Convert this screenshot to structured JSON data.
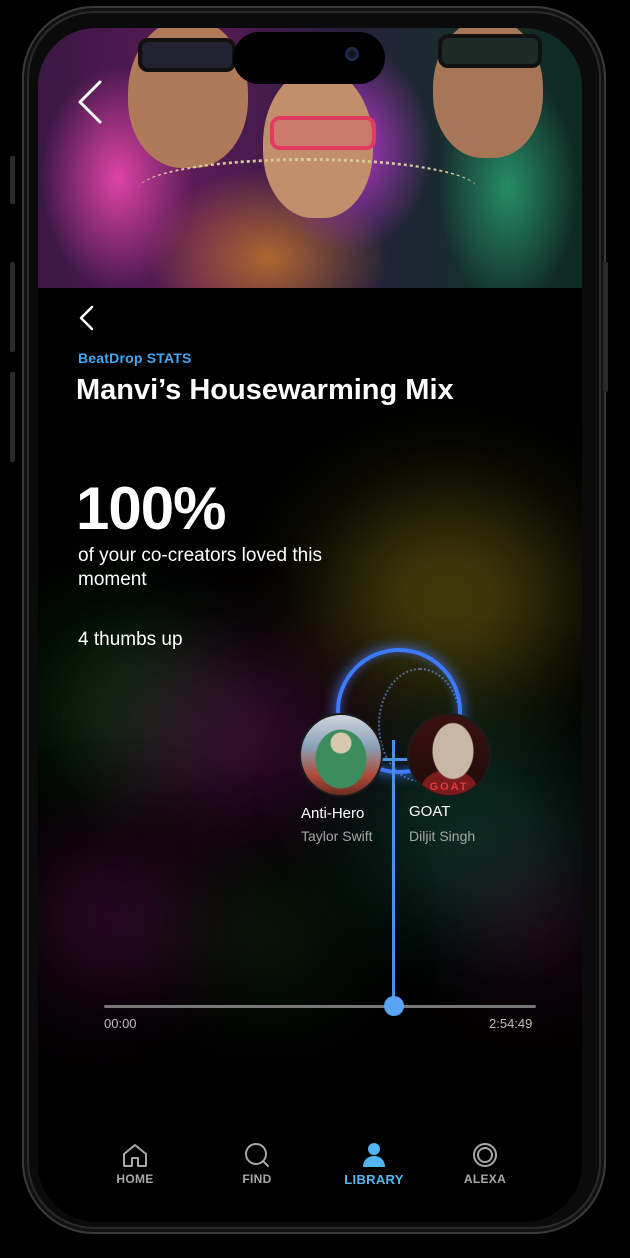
{
  "header": {
    "eyebrow": "BeatDrop STATS",
    "title": "Manvi’s Housewarming Mix"
  },
  "stat": {
    "value": "100%",
    "description": "of your co-creators loved this moment",
    "thumbs": "4 thumbs up"
  },
  "songs": [
    {
      "title": "Anti-Hero",
      "artist": "Taylor Swift"
    },
    {
      "title": "GOAT",
      "artist": "Diljit Singh",
      "cover_text": "GOAT"
    }
  ],
  "timeline": {
    "start": "00:00",
    "end": "2:54:49"
  },
  "nav": {
    "items": [
      {
        "label": "HOME",
        "icon": "home-icon"
      },
      {
        "label": "FIND",
        "icon": "search-icon"
      },
      {
        "label": "LIBRARY",
        "icon": "library-icon",
        "active": true
      },
      {
        "label": "ALEXA",
        "icon": "alexa-icon"
      }
    ]
  },
  "colors": {
    "accent": "#45a8f5",
    "timeline_line": "#4a90e8",
    "ring": "#3f7bff",
    "background": "#000000"
  }
}
